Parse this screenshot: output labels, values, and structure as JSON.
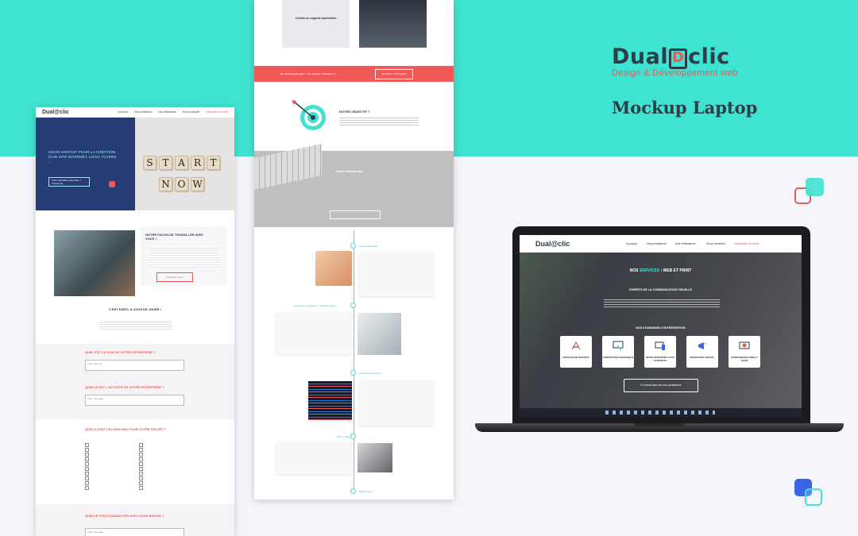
{
  "brand": {
    "logo": "Dual",
    "logo_d": "D",
    "logo_tail": "clic",
    "tagline": "Design & Développement web",
    "mockup_title": "Mockup Laptop"
  },
  "page1": {
    "logo": "Dual@clic",
    "nav": [
      "A propos",
      "Nos prestations",
      "Nos réalisations",
      "Nous contacter",
      "Demander un devis"
    ],
    "hero_text": "Devis gratuit pour la création d'un site internet, logo, flyers ...",
    "hero_button": "Vous souhaitez nous faire ? Trouvez-le",
    "hero_tiles": [
      "S",
      "T",
      "A",
      "R",
      "T",
      "N",
      "O",
      "W"
    ],
    "method_title": "Notre façon de travailler avec vous ?",
    "method_button": "Contactez-nous !",
    "ready_title": "C'est parti, à vous de jouer !",
    "q1": "Quel est le nom de votre entreprise ?",
    "q1_field": "Votre réponse",
    "q2": "Quelle est l'activité de votre entreprise ?",
    "q2_field": "Votre message",
    "q3": "Quels sont les besoins pour votre projet ?",
    "q4": "Quelle fonctionnalités avez-vous besoin ?",
    "q4_field": "Votre message"
  },
  "page2": {
    "card1": "Création de supports imprimables",
    "red_bar_text": "Vos données partagées : une nouvelle, réalisation en ...",
    "red_bar_button": "Demander un devis gratuit",
    "objective_title": "Notre objectif ?",
    "methodology_title": "Notre méthodologie",
    "timeline_labels": [
      "Analyse du projet",
      "Conception graphique · définition design",
      "Développement web",
      "Mise en ligne",
      "Maintenance"
    ]
  },
  "laptop": {
    "logo": "Dual@clic",
    "nav": [
      "A propos",
      "Nos prestations",
      "Nos réalisations",
      "Nous contacter",
      "Demander un devis"
    ],
    "title_prefix": "NOS",
    "title_accent": "SERVICES",
    "title_suffix": ": WEB ET PRINT",
    "subtitle": "EXPERTS DE LA COMMUNICATION VISUELLE",
    "domains_title": "NOS 5 DOMAINES D'INTERVENTION",
    "services": [
      {
        "label": "GESTION DE PROJETS",
        "icon": "project-icon"
      },
      {
        "label": "CONCEPTION GRAPHIQUE",
        "icon": "design-pen-icon"
      },
      {
        "label": "DÉVELOPPEMENT TOUS SUPPORTS",
        "icon": "devices-icon"
      },
      {
        "label": "MARKETING DIGITAL",
        "icon": "megaphone-icon"
      },
      {
        "label": "MAINTENANCE MISE À JOUR",
        "icon": "maintenance-icon"
      }
    ],
    "button": "En savoir plus sur nos prestations"
  },
  "colors": {
    "teal": "#3fe3d1",
    "coral": "#e85a5a",
    "navy": "#2f3d46"
  }
}
